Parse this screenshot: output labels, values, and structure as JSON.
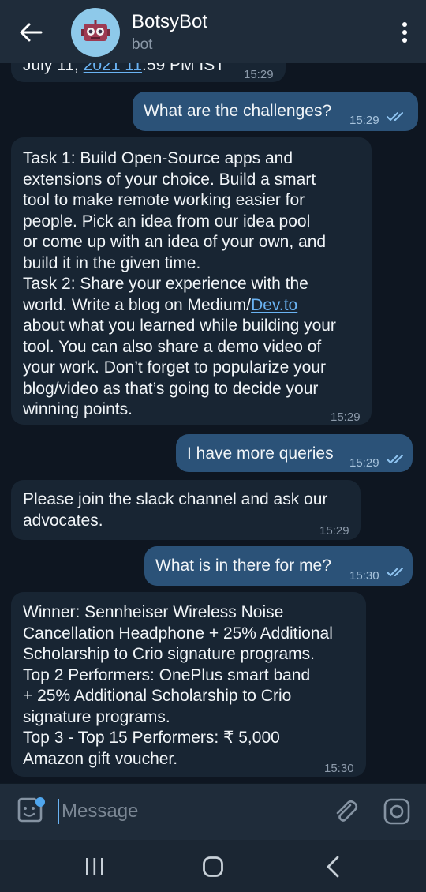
{
  "header": {
    "title": "BotsyBot",
    "subtitle": "bot"
  },
  "messages": [
    {
      "partial_text": "July 11, ",
      "partial_link": "2021 11",
      "partial_rest": ":59 PM IST",
      "time": "15:29"
    },
    {
      "text": "What are the challenges?",
      "time": "15:29",
      "status": "read"
    },
    {
      "lines": [
        "Task 1: Build Open-Source apps and",
        "extensions of your choice. Build a smart",
        "tool to make remote working easier for",
        "people. Pick an idea from our idea pool",
        "or come up with an idea of your own, and",
        "build it in the given time.",
        "Task 2: Share your experience with the",
        "world. Write a blog on Medium/",
        "about what you learned while building your",
        "tool. You can also share a demo video of",
        "your work. Don’t forget to popularize your",
        "blog/video as that’s going to decide your",
        "winning points."
      ],
      "link": "Dev.to",
      "time": "15:29"
    },
    {
      "text": "I have more queries",
      "time": "15:29",
      "status": "read"
    },
    {
      "lines": [
        "Please join the slack channel and ask our",
        "advocates."
      ],
      "time": "15:29"
    },
    {
      "text": "What is in there for me?",
      "time": "15:30",
      "status": "read"
    },
    {
      "lines": [
        "Winner: Sennheiser Wireless Noise",
        "Cancellation Headphone + 25% Additional",
        "Scholarship to Crio signature programs.",
        "Top 2 Performers: OnePlus smart band",
        "+ 25% Additional Scholarship to Crio",
        "signature programs.",
        "Top 3 - Top 15 Performers: ₹ 5,000",
        "Amazon gift voucher."
      ],
      "time": "15:30"
    }
  ],
  "input": {
    "placeholder": "Message"
  },
  "icons": {
    "back": "arrow-left-icon",
    "menu": "more-vertical-icon",
    "emoji": "sticker-emoji-icon",
    "attach": "paperclip-icon",
    "camera": "instagram-camera-icon",
    "recent": "recent-apps-icon",
    "home": "home-icon",
    "nav_back": "nav-back-icon"
  },
  "colors": {
    "background": "#0e1621",
    "header": "#1f2c3a",
    "incoming": "#182533",
    "outgoing": "#2b5278",
    "accent": "#6ab3f3"
  }
}
